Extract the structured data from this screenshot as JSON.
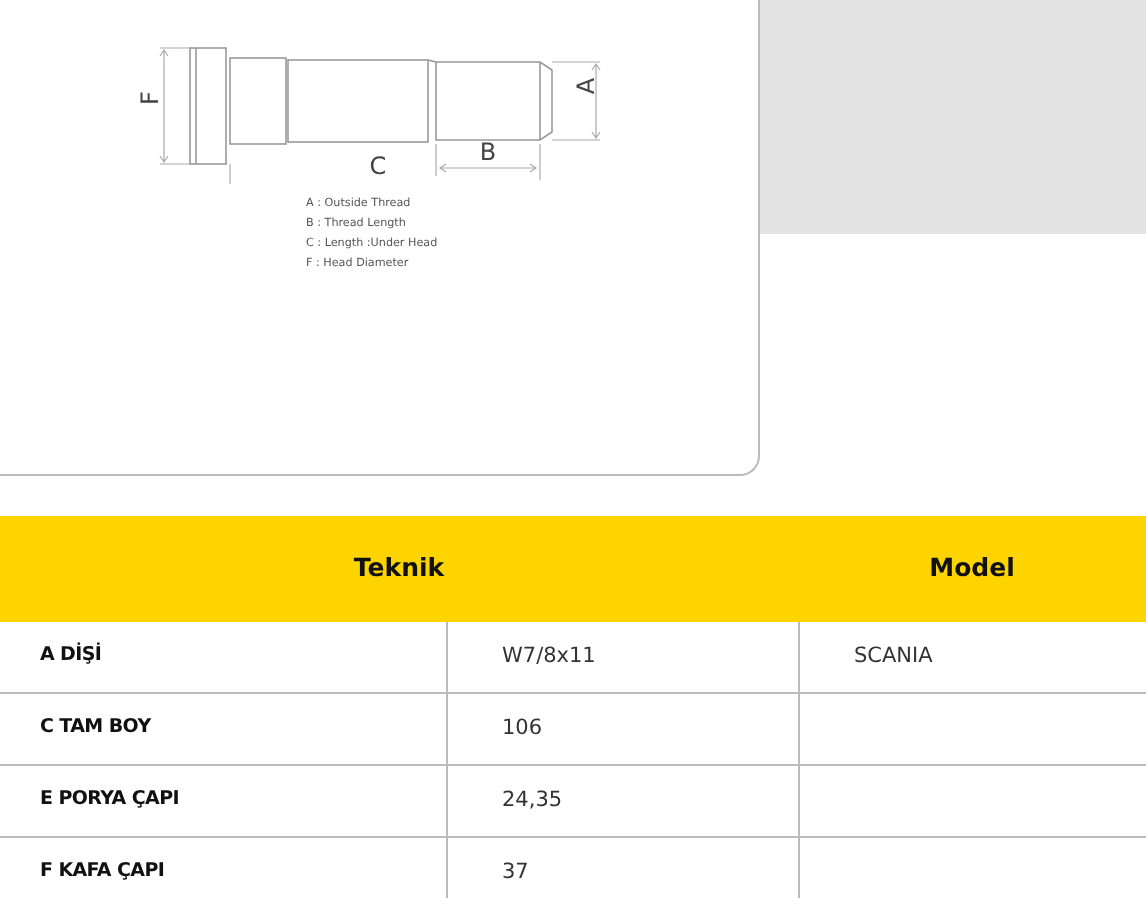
{
  "diagram": {
    "labels": [
      {
        "kind": "f",
        "text": "F"
      },
      {
        "kind": "c",
        "text": "C"
      },
      {
        "kind": "b",
        "text": "B"
      },
      {
        "kind": "a",
        "text": "A"
      }
    ],
    "legend": [
      "A : Outside Thread",
      "B : Thread Length",
      "C : Length :Under Head",
      "F : Head Diameter"
    ]
  },
  "table": {
    "columns": [
      "Teknik",
      "Model"
    ],
    "rows": [
      {
        "label": "A DİŞİ",
        "value": "W7/8x11",
        "model": "SCANIA"
      },
      {
        "label": "C TAM BOY",
        "value": "106"
      },
      {
        "label": "E PORYA ÇAPI",
        "value": "24,35"
      },
      {
        "label": "F KAFA ÇAPI",
        "value": "37"
      }
    ]
  }
}
